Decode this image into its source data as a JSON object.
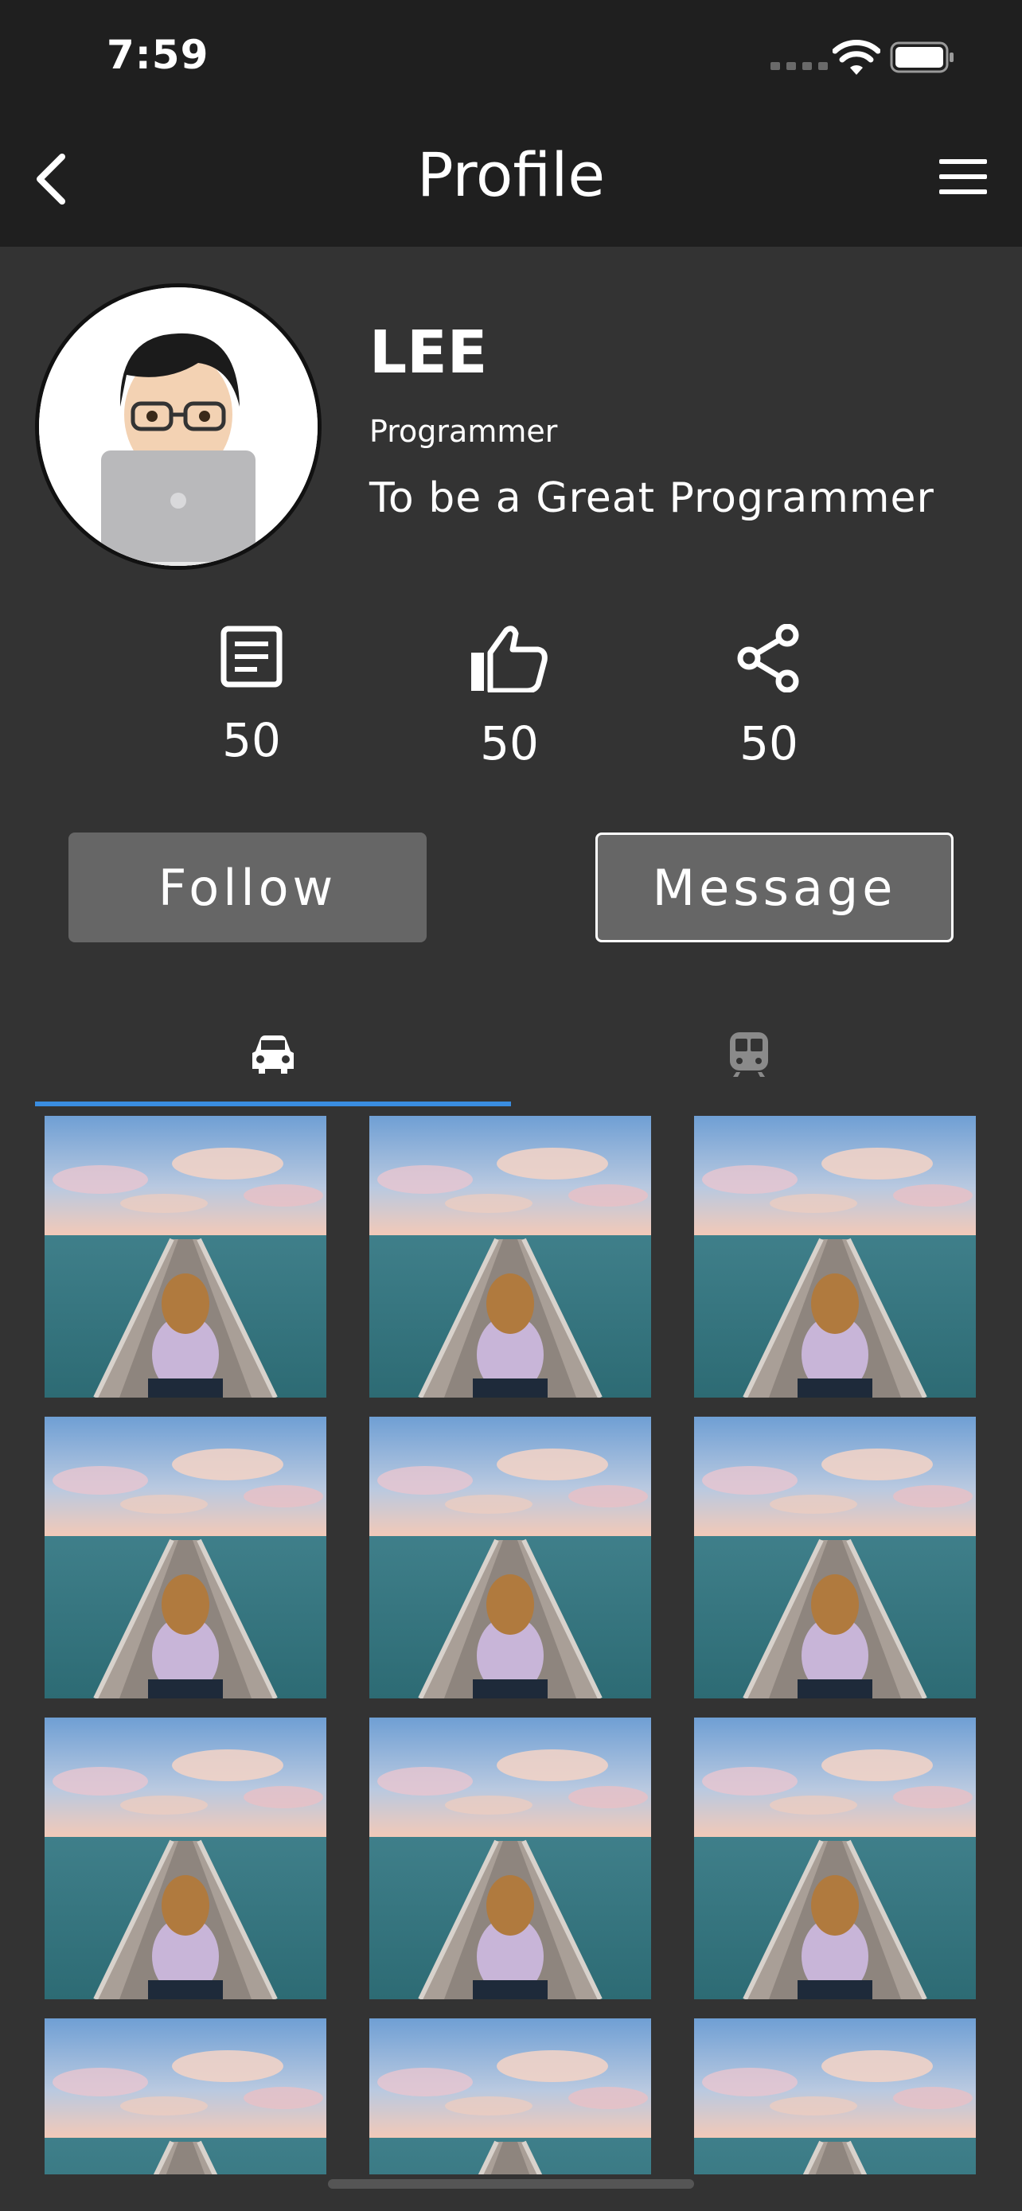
{
  "status_bar": {
    "time": "7:59"
  },
  "nav": {
    "title": "Profile"
  },
  "profile": {
    "name": "LEE",
    "role": "Programmer",
    "motto": "To be a Great Programmer"
  },
  "stats": [
    {
      "icon": "article-icon",
      "value": "50"
    },
    {
      "icon": "thumbs-up-icon",
      "value": "50"
    },
    {
      "icon": "share-icon",
      "value": "50"
    }
  ],
  "actions": {
    "follow_label": "Follow",
    "message_label": "Message"
  },
  "tabs": [
    {
      "icon": "car-icon",
      "active": true
    },
    {
      "icon": "train-icon",
      "active": false
    }
  ],
  "colors": {
    "background": "#333333",
    "bar": "#1f1f1f",
    "button": "#666666",
    "tab_underline": "#3a8de0"
  },
  "photo_grid": {
    "thumbnail": "woman-sitting-on-pier-photo",
    "count": 12
  }
}
